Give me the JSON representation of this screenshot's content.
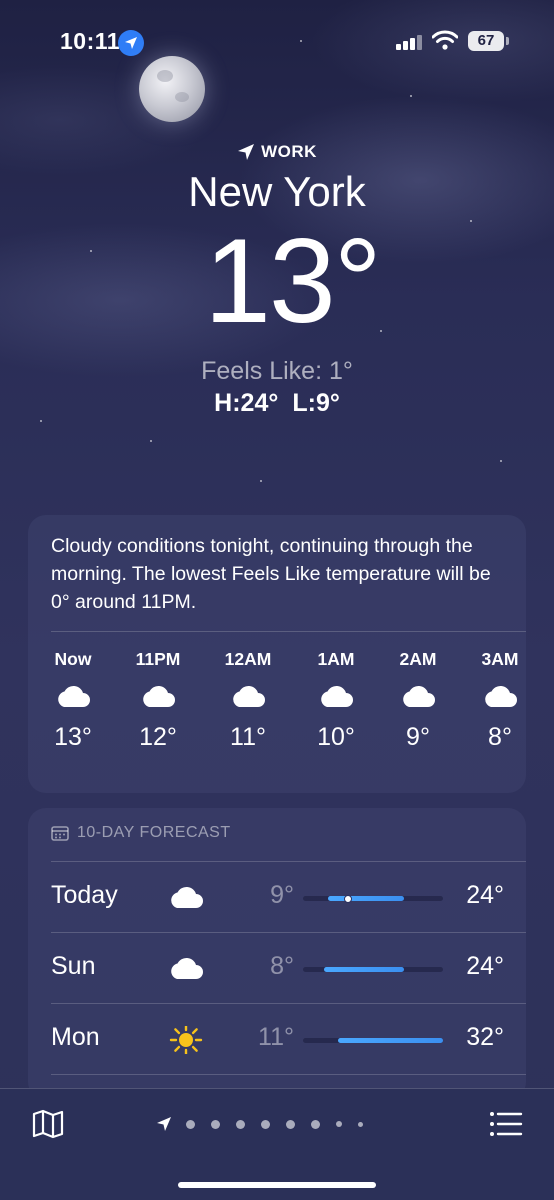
{
  "status_bar": {
    "time": "10:11",
    "battery": "67"
  },
  "header": {
    "location_label": "WORK",
    "city": "New York",
    "temperature": "13°",
    "feels_like": "Feels Like: 1°",
    "high": "H:24°",
    "low": "L:9°"
  },
  "hourly": {
    "summary": "Cloudy conditions tonight, continuing through the morning. The lowest Feels Like temperature will be 0° around 11PM.",
    "hours": [
      {
        "time": "Now",
        "icon": "cloud-icon",
        "temp": "13°"
      },
      {
        "time": "11PM",
        "icon": "cloud-icon",
        "temp": "12°"
      },
      {
        "time": "12AM",
        "icon": "cloud-icon",
        "temp": "11°"
      },
      {
        "time": "1AM",
        "icon": "cloud-icon",
        "temp": "10°"
      },
      {
        "time": "2AM",
        "icon": "cloud-icon",
        "temp": "9°"
      },
      {
        "time": "3AM",
        "icon": "cloud-icon",
        "temp": "8°"
      }
    ]
  },
  "forecast": {
    "header": "10-DAY FORECAST",
    "days": [
      {
        "day": "Today",
        "icon": "cloud-icon",
        "low": "9°",
        "high": "24°",
        "range_start": 0.18,
        "range_end": 0.72,
        "current": 0.32
      },
      {
        "day": "Sun",
        "icon": "cloud-icon",
        "low": "8°",
        "high": "24°",
        "range_start": 0.15,
        "range_end": 0.72
      },
      {
        "day": "Mon",
        "icon": "sun-icon",
        "low": "11°",
        "high": "32°",
        "range_start": 0.25,
        "range_end": 1.0
      }
    ]
  },
  "colors": {
    "accent_blue": "#2f7df6",
    "range_bar": "#4aa8ff",
    "sun": "#f7c21b"
  },
  "page_indicator": {
    "count": 9,
    "active": 0
  }
}
